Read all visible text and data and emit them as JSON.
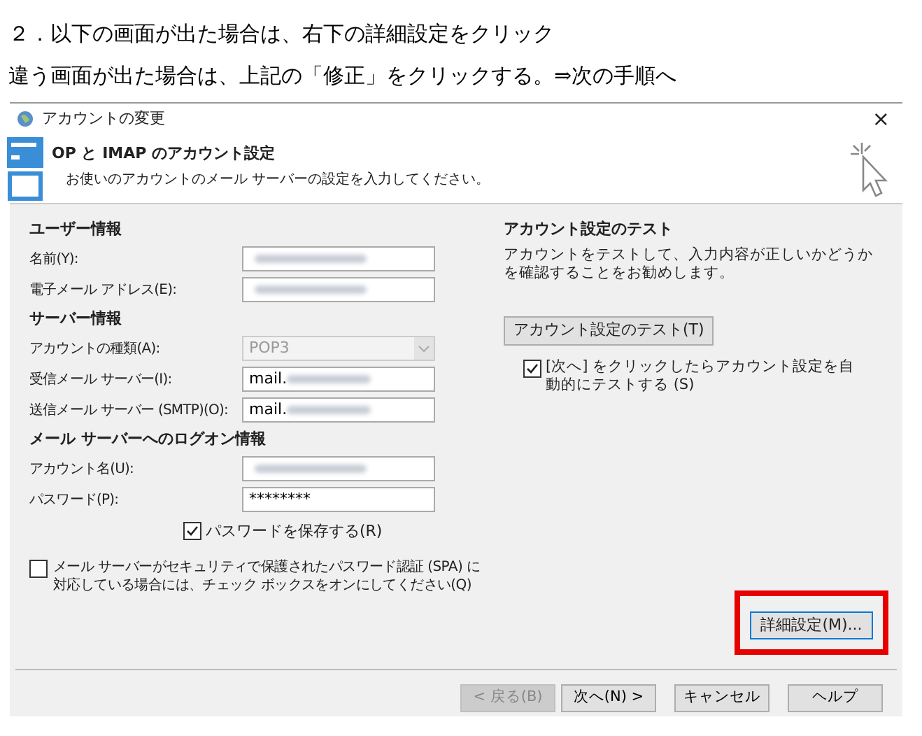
{
  "document": {
    "lines": [
      "２．以下の画面が出た場合は、右下の詳細設定をクリック",
      "違う画面が出た場合は、上記の「修正」をクリックする。⇒次の手順へ"
    ]
  },
  "dialog": {
    "title": "アカウントの変更",
    "close": "×",
    "header": {
      "title": "OP と IMAP のアカウント設定",
      "subtitle": "お使いのアカウントのメール サーバーの設定を入力してください。"
    },
    "sections": [
      {
        "heading": "ユーザー情報",
        "fields": [
          {
            "label": "名前(Y):",
            "kind": "blurred"
          },
          {
            "label": "電子メール アドレス(E):",
            "kind": "blurred"
          }
        ]
      },
      {
        "heading": "サーバー情報",
        "fields": [
          {
            "label": "アカウントの種類(A):",
            "kind": "combo",
            "value": "POP3",
            "disabled": true
          },
          {
            "label": "受信メール サーバー(I):",
            "kind": "partial",
            "value": "mail."
          },
          {
            "label": "送信メール サーバー (SMTP)(O):",
            "kind": "partial",
            "value": "mail."
          }
        ]
      },
      {
        "heading": "メール サーバーへのログオン情報",
        "fields": [
          {
            "label": "アカウント名(U):",
            "kind": "blurred"
          },
          {
            "label": "パスワード(P):",
            "kind": "text",
            "value": "********"
          }
        ]
      }
    ],
    "remember_password": {
      "label": "パスワードを保存する(R)",
      "checked": true
    },
    "spa": {
      "label": "メール サーバーがセキュリティで保護されたパスワード認証 (SPA) に対応している場合には、チェック ボックスをオンにしてください(Q)",
      "checked": false
    },
    "test": {
      "heading": "アカウント設定のテスト",
      "description": "アカウントをテストして、入力内容が正しいかどうかを確認することをお勧めします。",
      "button": "アカウント設定のテスト(T)",
      "auto_test": {
        "label": "[次へ] をクリックしたらアカウント設定を自動的にテストする (S)",
        "checked": true
      }
    },
    "advanced_button": {
      "label": "詳細設定(M)...",
      "highlighted": true
    },
    "footer_buttons": [
      {
        "label": "< 戻る(B)",
        "disabled": true
      },
      {
        "label": "次へ(N) >",
        "disabled": false
      },
      {
        "label": "キャンセル",
        "disabled": false
      },
      {
        "label": "ヘルプ",
        "disabled": false
      }
    ]
  }
}
